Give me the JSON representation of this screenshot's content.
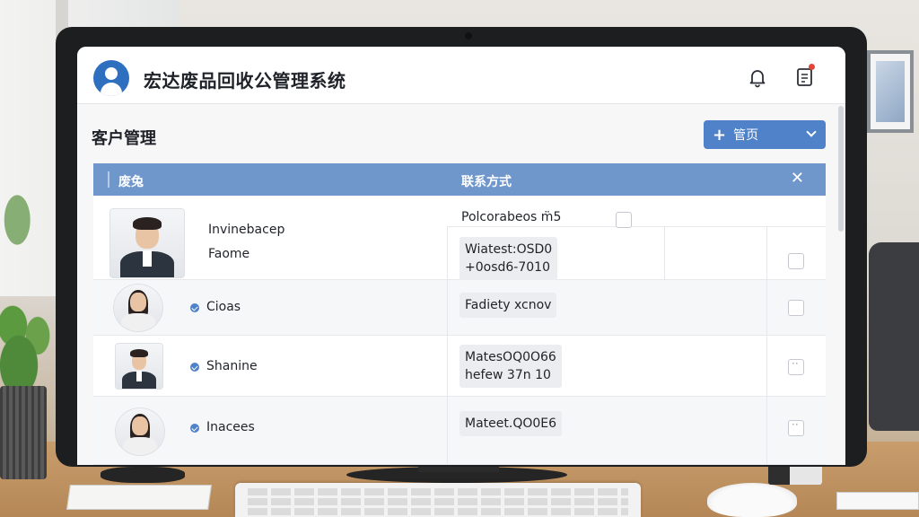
{
  "app": {
    "title": "宏达废品回收公管理系统"
  },
  "page": {
    "title": "客户管理",
    "add_button_label": "管页"
  },
  "table": {
    "headers": {
      "name": "废兔",
      "contact": "联系方式",
      "close": "✕"
    },
    "rows": [
      {
        "name": "Invinebacep",
        "subname": "Faome",
        "contact_top": "Polcorabeos m̈5",
        "contact_chip": [
          "Wiatest:OSD0",
          "+0osd6-7010"
        ]
      },
      {
        "name": "Cioas",
        "contact_chip": [
          "Fadiety xcnov"
        ]
      },
      {
        "name": "Shanine",
        "contact_chip": [
          "MatesOQ0O66",
          "hefew 37n 10"
        ]
      },
      {
        "name": "Inacees",
        "contact_chip": [
          "Mateet.QO0E6"
        ]
      }
    ]
  },
  "icons": {
    "logo": "user-avatar-icon",
    "notifications": "bell-icon",
    "messages": "document-icon"
  },
  "colors": {
    "accent": "#4f82c8",
    "header_row": "#6f97cc",
    "logo": "#2f6fbf",
    "badge": "#e0463b"
  }
}
